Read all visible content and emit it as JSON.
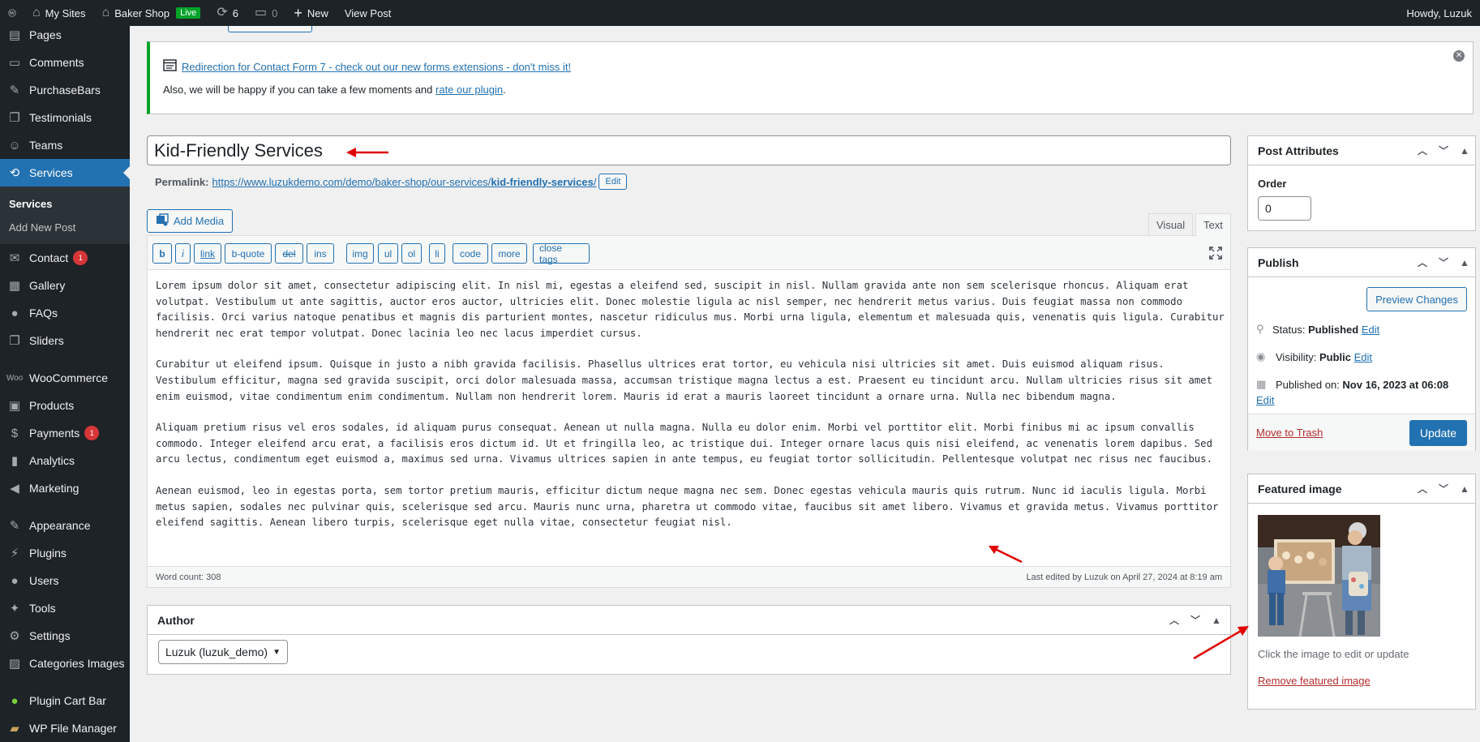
{
  "admin_bar": {
    "my_sites": "My Sites",
    "site_name": "Baker Shop",
    "live_badge": "Live",
    "updates_count": "6",
    "comments_count": "0",
    "new_label": "New",
    "view_post": "View Post",
    "howdy": "Howdy, Luzuk"
  },
  "sidebar": {
    "pages": "Pages",
    "comments": "Comments",
    "purchasebars": "PurchaseBars",
    "testimonials": "Testimonials",
    "teams": "Teams",
    "services": "Services",
    "sub_services": "Services",
    "sub_add_new": "Add New Post",
    "contact": "Contact",
    "contact_badge": "1",
    "gallery": "Gallery",
    "faqs": "FAQs",
    "sliders": "Sliders",
    "woocommerce": "WooCommerce",
    "products": "Products",
    "payments": "Payments",
    "payments_badge": "1",
    "analytics": "Analytics",
    "marketing": "Marketing",
    "appearance": "Appearance",
    "plugins": "Plugins",
    "users": "Users",
    "tools": "Tools",
    "settings": "Settings",
    "categories_images": "Categories Images",
    "plugin_cart_bar": "Plugin Cart Bar",
    "wp_file_manager": "WP File Manager"
  },
  "notice": {
    "link_text": "Redirection for Contact Form 7 - check out our new forms extensions - don't miss it!",
    "text_before": "Also, we will be happy if you can take a few moments and ",
    "rate_link": "rate our plugin",
    "text_after": "."
  },
  "post": {
    "title": "Kid-Friendly Services",
    "permalink_label": "Permalink:",
    "permalink_base": "https://www.luzukdemo.com/demo/baker-shop/our-services/",
    "permalink_slug": "kid-friendly-services",
    "permalink_end": "/",
    "edit_slug": "Edit"
  },
  "editor": {
    "add_media": "Add Media",
    "tab_visual": "Visual",
    "tab_text": "Text",
    "qt_buttons": [
      "b",
      "i",
      "link",
      "b-quote",
      "del",
      "ins",
      "img",
      "ul",
      "ol",
      "li",
      "code",
      "more",
      "close tags"
    ],
    "paragraphs": [
      "Lorem ipsum dolor sit amet, consectetur adipiscing elit. In nisl mi, egestas a eleifend sed, suscipit in nisl. Nullam gravida ante non sem scelerisque rhoncus. Aliquam erat volutpat. Vestibulum ut ante sagittis, auctor eros auctor, ultricies elit. Donec molestie ligula ac nisl semper, nec hendrerit metus varius. Duis feugiat massa non commodo facilisis. Orci varius natoque penatibus et magnis dis parturient montes, nascetur ridiculus mus. Morbi urna ligula, elementum et malesuada quis, venenatis quis ligula. Curabitur hendrerit nec erat tempor volutpat. Donec lacinia leo nec lacus imperdiet cursus.",
      "Curabitur ut eleifend ipsum. Quisque in justo a nibh gravida facilisis. Phasellus ultrices erat tortor, eu vehicula nisi ultricies sit amet. Duis euismod aliquam risus. Vestibulum efficitur, magna sed gravida suscipit, orci dolor malesuada massa, accumsan tristique magna lectus a est. Praesent eu tincidunt arcu. Nullam ultricies risus sit amet enim euismod, vitae condimentum enim condimentum. Nullam non hendrerit lorem. Mauris id erat a mauris laoreet tincidunt a ornare urna. Nulla nec bibendum magna.",
      "Aliquam pretium risus vel eros sodales, id aliquam purus consequat. Aenean ut nulla magna. Nulla eu dolor enim. Morbi vel porttitor elit. Morbi finibus mi ac ipsum convallis commodo. Integer eleifend arcu erat, a facilisis eros dictum id. Ut et fringilla leo, ac tristique dui. Integer ornare lacus quis nisi eleifend, ac venenatis lorem dapibus. Sed arcu lectus, condimentum eget euismod a, maximus sed urna. Vivamus ultrices sapien in ante tempus, eu feugiat tortor sollicitudin. Pellentesque volutpat nec risus nec faucibus.",
      "Aenean euismod, leo in egestas porta, sem tortor pretium mauris, efficitur dictum neque magna nec sem. Donec egestas vehicula mauris quis rutrum. Nunc id iaculis ligula. Morbi metus sapien, sodales nec pulvinar quis, scelerisque sed arcu. Mauris nunc urna, pharetra ut commodo vitae, faucibus sit amet libero. Vivamus et gravida metus. Vivamus porttitor eleifend sagittis. Aenean libero turpis, scelerisque eget nulla vitae, consectetur feugiat nisl."
    ],
    "word_count": "Word count: 308",
    "last_edited": "Last edited by Luzuk on April 27, 2024 at 8:19 am"
  },
  "author_box": {
    "title": "Author",
    "selected": "Luzuk (luzuk_demo)"
  },
  "attributes_box": {
    "title": "Post Attributes",
    "order_label": "Order",
    "order_value": "0"
  },
  "publish_box": {
    "title": "Publish",
    "preview": "Preview Changes",
    "status_label": "Status:",
    "status_value": "Published",
    "visibility_label": "Visibility:",
    "visibility_value": "Public",
    "published_label": "Published on:",
    "published_value": "Nov 16, 2023 at 06:08",
    "edit": "Edit",
    "trash": "Move to Trash",
    "update": "Update"
  },
  "featured_box": {
    "title": "Featured image",
    "hint": "Click the image to edit or update",
    "remove": "Remove featured image"
  },
  "colors": {
    "accent": "#2271b1",
    "admin_dark": "#1d2327",
    "notice_green": "#00a32a",
    "badge_red": "#d63638",
    "annotation_red": "#e00000"
  }
}
